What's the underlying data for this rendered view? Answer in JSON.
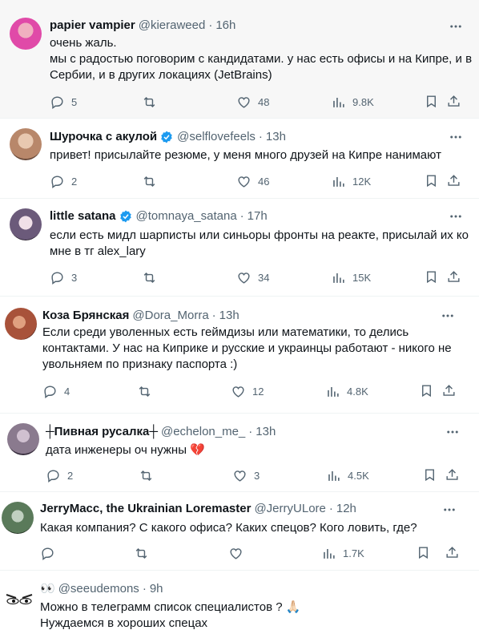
{
  "tweets": [
    {
      "name": "papier vampier",
      "handle": "@kieraweed",
      "time": "16h",
      "verified": false,
      "lines": [
        "очень жаль.",
        "мы с радостью поговорим с кандидатами. у нас есть офисы и на Кипре, и в",
        "Сербии, и в других локациях (JetBrains)"
      ],
      "replies": "5",
      "retweets": "",
      "likes": "48",
      "views": "9.8K",
      "avatar_color": "#e04aa8"
    },
    {
      "name": "Шурочка с акулой",
      "handle": "@selflovefeels",
      "time": "13h",
      "verified": true,
      "lines": [
        "привет! присылайте резюме, у меня много друзей на Кипре нанимают"
      ],
      "replies": "2",
      "retweets": "",
      "likes": "46",
      "views": "12K",
      "avatar_color": "#b8876a"
    },
    {
      "name": "little satana",
      "handle": "@tomnaya_satana",
      "time": "17h",
      "verified": true,
      "lines": [
        "если есть мидл шарписты или синьоры фронты на реакте, присылай их ко",
        "мне в тг alex_lary"
      ],
      "replies": "3",
      "retweets": "",
      "likes": "34",
      "views": "15K",
      "avatar_color": "#6b5a7a"
    },
    {
      "name": "Коза Брянская",
      "handle": "@Dora_Morra",
      "time": "13h",
      "verified": false,
      "lines": [
        "Если среди уволенных есть геймдизы или математики, то делись",
        "контактами. У нас на Киприке и русские и украинцы работают -  никого не",
        "увольняем по признаку паспорта :)"
      ],
      "replies": "4",
      "retweets": "",
      "likes": "12",
      "views": "4.8K",
      "avatar_color": "#a8523a"
    },
    {
      "name": "┼Пивная русалка┼",
      "handle": "@echelon_me_",
      "time": "13h",
      "verified": false,
      "lines": [
        "дата инженеры оч нужны 💔"
      ],
      "replies": "2",
      "retweets": "",
      "likes": "3",
      "views": "4.5K",
      "avatar_color": "#8a7a8e"
    },
    {
      "name": "JerryMacc, the Ukrainian Loremaster",
      "handle": "@JerryULore",
      "time": "12h",
      "verified": false,
      "lines": [
        "Какая компания? С какого офиса? Каких спецов? Кого ловить, где?"
      ],
      "replies": "",
      "retweets": "",
      "likes": "",
      "views": "1.7K",
      "avatar_color": "#5a7a5a"
    },
    {
      "name": "👀",
      "handle": "@seeudemons",
      "time": "9h",
      "verified": false,
      "lines": [
        "Можно в телеграмм список специалистов ? 🙏🏻",
        "Нуждаемся в хороших спецах"
      ],
      "replies": "",
      "retweets": "",
      "likes": "",
      "views": "",
      "avatar_color": "#ffffff"
    }
  ],
  "colors": {
    "text": "#0f1419",
    "secondary": "#536471",
    "verified": "#1d9bf0",
    "border": "#eff3f4"
  }
}
